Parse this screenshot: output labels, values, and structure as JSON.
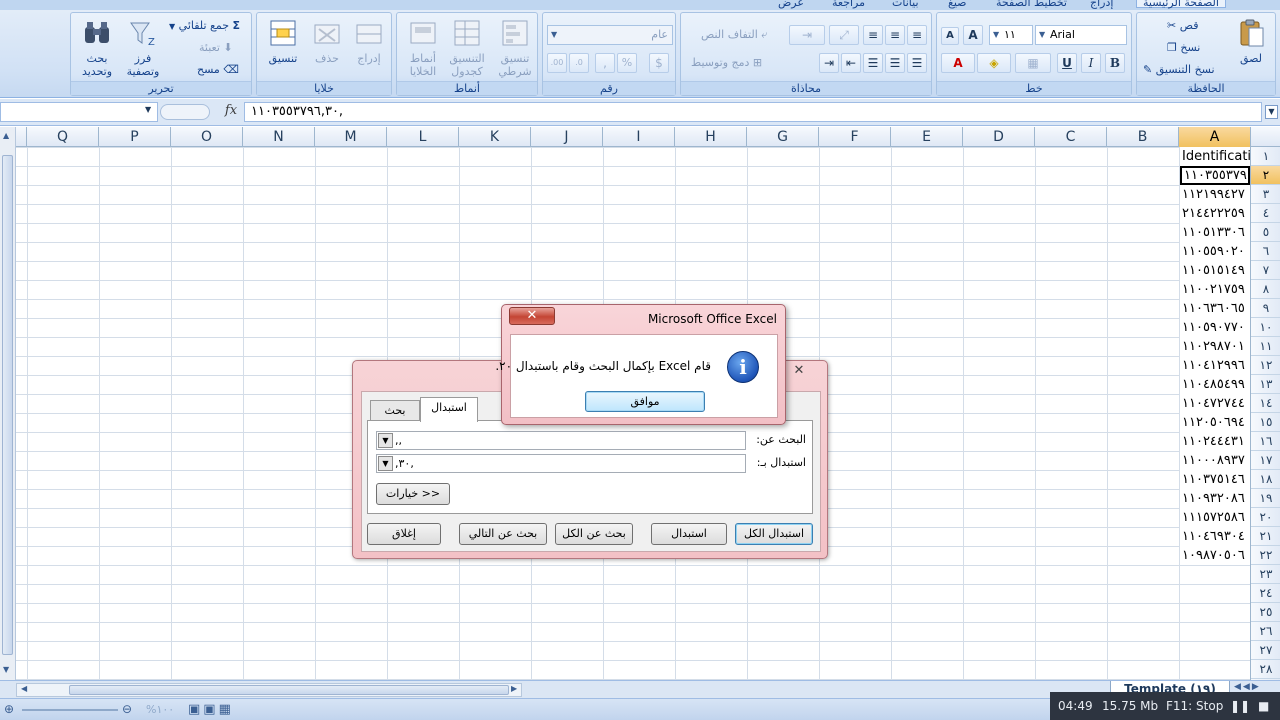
{
  "ribbon": {
    "tabs": [
      {
        "label": "عرض",
        "active": false
      },
      {
        "label": "مراجعة",
        "active": false
      },
      {
        "label": "بيانات",
        "active": false
      },
      {
        "label": "صيغ",
        "active": false
      },
      {
        "label": "تخطيط الصفحة",
        "active": false
      },
      {
        "label": "إدراج",
        "active": false
      },
      {
        "label": "الصفحة الرئيسية",
        "active": true
      }
    ],
    "clipboard": {
      "label": "الحافظة",
      "paste": "لصق",
      "cut": "قص",
      "copy": "نسخ",
      "format_painter": "نسخ التنسيق"
    },
    "font": {
      "label": "خط",
      "font_name": "Arial",
      "font_size": "١١",
      "bold": "B",
      "italic": "I",
      "underline": "U",
      "grow": "A",
      "shrink": "A"
    },
    "alignment": {
      "label": "محاذاة",
      "wrap_text": "التفاف النص",
      "merge_center": "دمج وتوسيط"
    },
    "number": {
      "label": "رقم",
      "format": "عام",
      "percent": "%",
      "comma": ",",
      "inc_decimal": ".00",
      "dec_decimal": ".0"
    },
    "styles": {
      "label": "أنماط",
      "conditional": "تنسيق شرطي",
      "format_table": "التنسيق كجدول",
      "cell_styles": "أنماط الخلايا"
    },
    "cells": {
      "label": "خلايا",
      "insert": "إدراج",
      "delete": "حذف",
      "format": "تنسيق"
    },
    "editing": {
      "label": "تحرير",
      "autosum": "جمع تلقائي",
      "fill": "تعبئة",
      "clear": "مسح",
      "sort_filter": "فرز وتصفية",
      "find_select": "بحث وتحديد"
    }
  },
  "formula_bar": {
    "fx": "fx",
    "value": "١١٠٣٥٥٣٧٩٦,٣٠,"
  },
  "columns": [
    "A",
    "B",
    "C",
    "D",
    "E",
    "F",
    "G",
    "H",
    "I",
    "J",
    "K",
    "L",
    "M",
    "N",
    "O",
    "P",
    "Q"
  ],
  "rows": [
    "١",
    "٢",
    "٣",
    "٤",
    "٥",
    "٦",
    "٧",
    "٨",
    "٩",
    "١٠",
    "١١",
    "١٢",
    "١٣",
    "١٤",
    "١٥",
    "١٦",
    "١٧",
    "١٨",
    "١٩",
    "٢٠",
    "٢١",
    "٢٢",
    "٢٣",
    "٢٤",
    "٢٥",
    "٢٦",
    "٢٧",
    "٢٨"
  ],
  "column_a": [
    "Identification",
    "١١٠٣٥٥٣٧٩",
    "١١٢١٩٩٤٢٧",
    "٢١٤٤٢٢٢٥٩",
    "١١٠٥١٣٣٠٦",
    "١١٠٥٥٩٠٢٠",
    "١١٠٥١٥١٤٩",
    "١١٠٠٢١٧٥٩",
    "١١٠٦٣٦٠٦٥",
    "١١٠٥٩٠٧٧٠",
    "١١٠٢٩٨٧٠١",
    "١١٠٤١٢٩٩٦",
    "١١٠٤٨٥٤٩٩",
    "١١٠٤٧٢٧٤٤",
    "١١٢٠٥٠٦٩٤",
    "١١٠٢٤٤٤٣١",
    "١١٠٠٠٨٩٣٧",
    "١١٠٣٧٥١٤٦",
    "١١٠٩٣٢٠٨٦",
    "١١١٥٧٢٥٨٦",
    "١١٠٤٦٩٣٠٤",
    "١٠٩٨٧٠٥٠٦"
  ],
  "find_dialog": {
    "tab_find": "بحث",
    "tab_replace": "استبدال",
    "find_label": "البحث عن:",
    "find_value": ",,",
    "replace_label": "استبدال بـ:",
    "replace_value": ",٣٠,",
    "options": "خيارات >>",
    "replace_all": "استبدال الكل",
    "replace": "استبدال",
    "find_all": "بحث عن الكل",
    "find_next": "بحث عن التالي",
    "close": "إغلاق",
    "close_glyph": "✕"
  },
  "message_box": {
    "title": "Microsoft Office Excel",
    "text": "قام Excel بإكمال البحث وقام باستبدال ٢٠.",
    "ok": "موافق",
    "close_glyph": "✕",
    "icon_glyph": "i"
  },
  "sheet_tab": "Template (١٩)",
  "status": {
    "zoom": "%١٠٠",
    "time": "04:49",
    "size": "15.75 Mb",
    "stop": "F11: Stop"
  },
  "colors": {
    "ribbon_bg": "#d1e1f5",
    "active_header": "#f1c15f",
    "dialog_frame": "#f3c1c6",
    "close_button": "#c44534",
    "info_icon": "#1f55b8"
  },
  "icons": {
    "paste": "clipboard-icon",
    "cut": "scissors-icon",
    "copy": "copy-icon",
    "format_painter": "brush-icon",
    "autosum": "sigma-icon",
    "find": "binoculars-icon",
    "sort": "funnel-icon",
    "info": "info-icon"
  }
}
